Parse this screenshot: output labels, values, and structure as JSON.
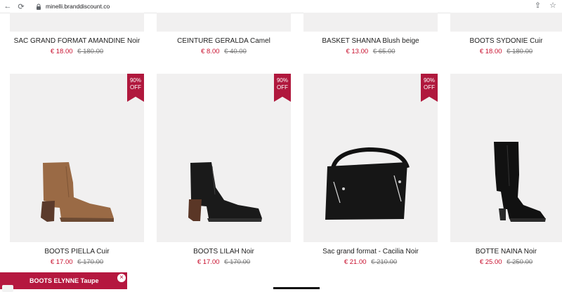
{
  "browser": {
    "url": "minelli.branddiscount.co",
    "icons": [
      "back-icon",
      "reload-icon",
      "lock-icon",
      "share-icon",
      "star-icon"
    ]
  },
  "products_top": [
    {
      "title": "SAC GRAND FORMAT AMANDINE Noir",
      "price": "€ 18.00",
      "old_price": "€ 180.00"
    },
    {
      "title": "CEINTURE GERALDA Camel",
      "price": "€ 8.00",
      "old_price": "€ 40.00"
    },
    {
      "title": "BASKET SHANNA Blush beige",
      "price": "€ 13.00",
      "old_price": "€ 65.00"
    },
    {
      "title": "BOOTS SYDONIE Cuir",
      "price": "€ 18.00",
      "old_price": "€ 180.00"
    }
  ],
  "products_bottom": [
    {
      "title": "BOOTS PIELLA Cuir",
      "price": "€ 17.00",
      "old_price": "€ 170.00",
      "badge": "90%\nOFF"
    },
    {
      "title": "BOOTS LILAH Noir",
      "price": "€ 17.00",
      "old_price": "€ 170.00",
      "badge": "90%\nOFF"
    },
    {
      "title": "Sac grand format - Cacilia Noir",
      "price": "€ 21.00",
      "old_price": "€ 210.00",
      "badge": "90%\nOFF"
    },
    {
      "title": "BOTTE NAINA Noir",
      "price": "€ 25.00",
      "old_price": "€ 250.00"
    }
  ],
  "popup": {
    "title": "BOOTS ELYNNE Taupe"
  }
}
